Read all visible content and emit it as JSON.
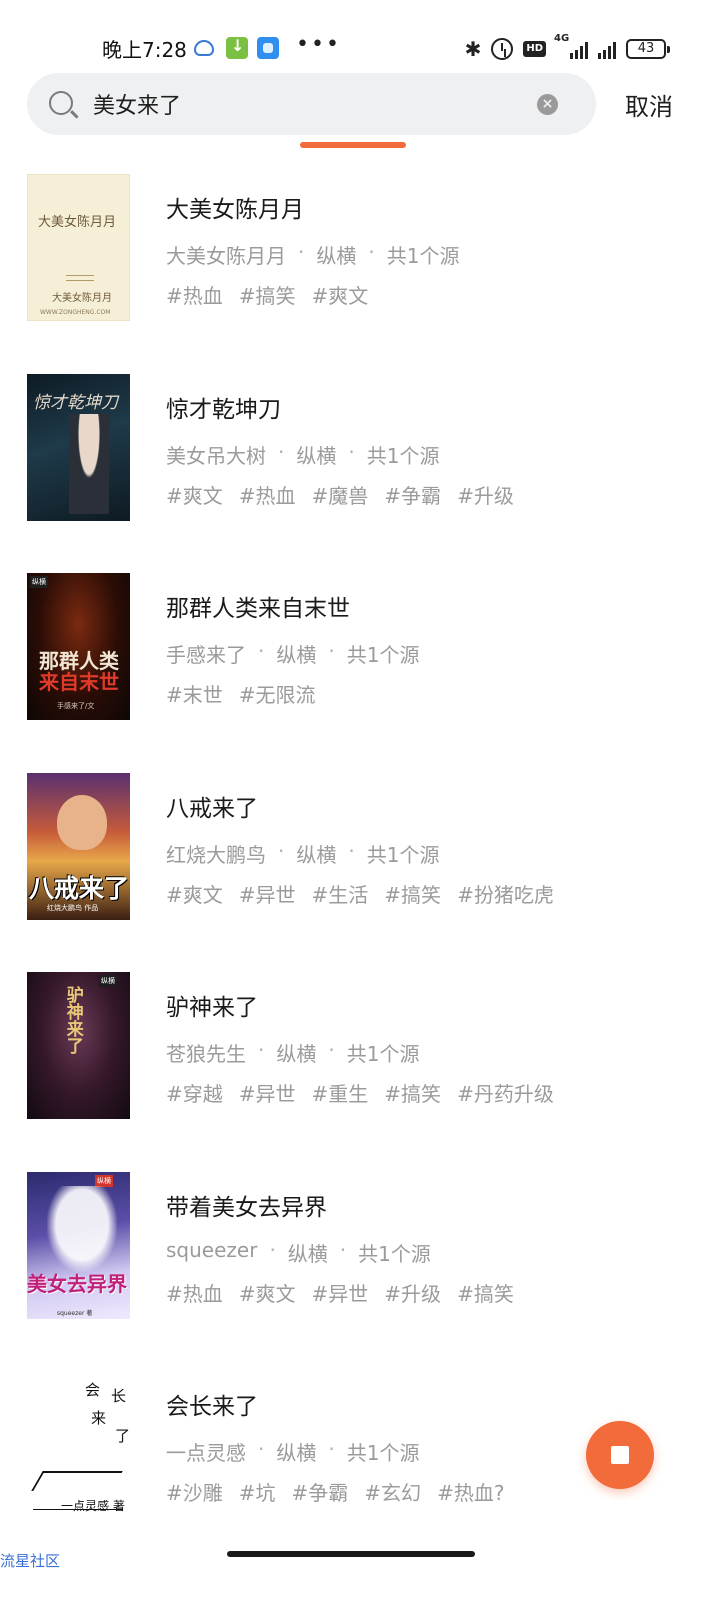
{
  "status_bar": {
    "time": "晚上7:28",
    "signal_label": "4G",
    "battery": "43"
  },
  "search": {
    "query": "美女来了",
    "cancel_label": "取消"
  },
  "colors": {
    "accent": "#f26b3a",
    "meta_text": "#9b9b9b",
    "title_text": "#1a1a1a"
  },
  "results": [
    {
      "title": "大美女陈月月",
      "author": "大美女陈月月",
      "category": "纵横",
      "sources": "共1个源",
      "tags": [
        "#热血",
        "#搞笑",
        "#爽文"
      ],
      "cover": {
        "title_text": "大美女陈月月",
        "author_text": "大美女陈月月",
        "site_text": "WWW.ZONGHENG.COM"
      }
    },
    {
      "title": "惊才乾坤刀",
      "author": "美女吊大树",
      "category": "纵横",
      "sources": "共1个源",
      "tags": [
        "#爽文",
        "#热血",
        "#魔兽",
        "#争霸",
        "#升级"
      ],
      "cover": {
        "title_text": "惊才乾坤刀"
      }
    },
    {
      "title": "那群人类来自末世",
      "author": "手感来了",
      "category": "纵横",
      "sources": "共1个源",
      "tags": [
        "#末世",
        "#无限流"
      ],
      "cover": {
        "line1": "那群人类",
        "line2": "来自末世",
        "sub": "手感来了/文",
        "badge": "纵横"
      }
    },
    {
      "title": "八戒来了",
      "author": "红烧大鹏鸟",
      "category": "纵横",
      "sources": "共1个源",
      "tags": [
        "#爽文",
        "#异世",
        "#生活",
        "#搞笑",
        "#扮猪吃虎"
      ],
      "cover": {
        "title_text": "八戒来了",
        "sub": "红烧大鹏鸟 作品"
      }
    },
    {
      "title": "驴神来了",
      "author": "苍狼先生",
      "category": "纵横",
      "sources": "共1个源",
      "tags": [
        "#穿越",
        "#异世",
        "#重生",
        "#搞笑",
        "#丹药升级"
      ],
      "cover": {
        "title_text": "驴神来了",
        "badge": "纵横"
      }
    },
    {
      "title": "带着美女去异界",
      "author": "squeezer",
      "category": "纵横",
      "sources": "共1个源",
      "tags": [
        "#热血",
        "#爽文",
        "#异世",
        "#升级",
        "#搞笑"
      ],
      "cover": {
        "title_text": "美女去异界",
        "sub": "squeezer 著",
        "badge": "纵横"
      }
    },
    {
      "title": "会长来了",
      "author": "一点灵感",
      "category": "纵横",
      "sources": "共1个源",
      "tags": [
        "#沙雕",
        "#坑",
        "#争霸",
        "#玄幻",
        "#热血?"
      ],
      "cover": {
        "c1": "会",
        "c2": "长",
        "c3": "来",
        "c4": "了",
        "sub": "一点灵感 著"
      }
    }
  ],
  "watermark": "流星社区",
  "icons": {
    "search": "search-icon",
    "clear": "clear-icon",
    "stop": "stop-icon"
  }
}
